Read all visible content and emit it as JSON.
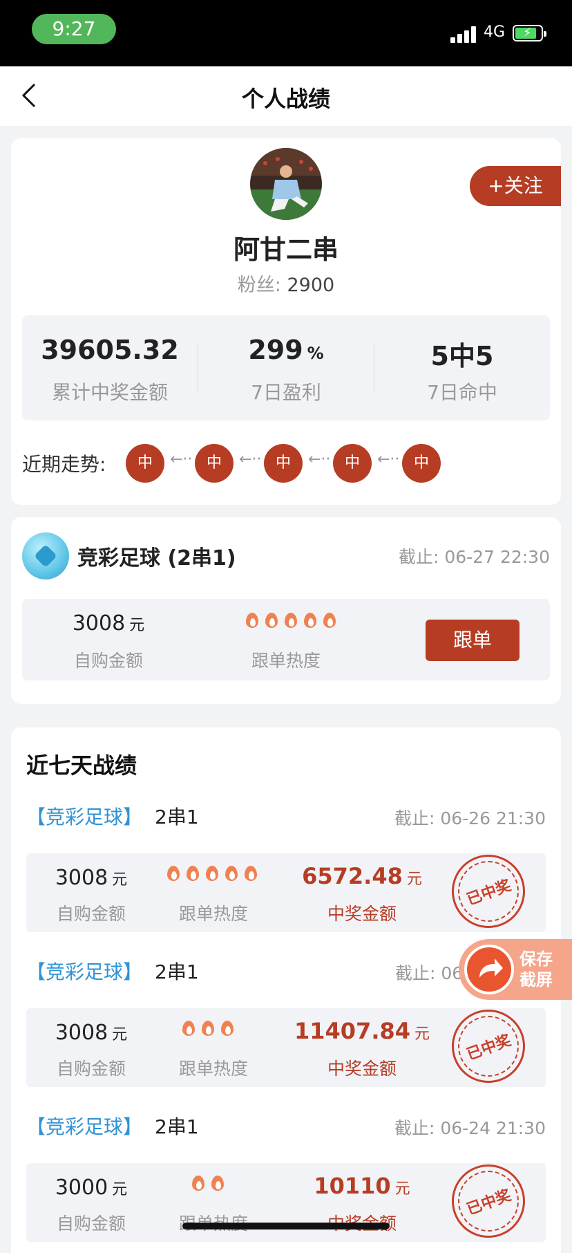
{
  "status_bar": {
    "time": "9:27",
    "network": "4G"
  },
  "nav": {
    "title": "个人战绩"
  },
  "profile": {
    "name": "阿甘二串",
    "fans_label": "粉丝:",
    "fans_value": "2900",
    "follow_label": "+关注",
    "stats": [
      {
        "value": "39605.32",
        "unit": "",
        "label": "累计中奖金额"
      },
      {
        "value": "299",
        "unit": "%",
        "label": "7日盈利"
      },
      {
        "value": "5中5",
        "unit": "",
        "label": "7日命中"
      }
    ],
    "trend_label": "近期走势:",
    "trend": [
      "中",
      "中",
      "中",
      "中",
      "中"
    ],
    "trend_arrow": "←··"
  },
  "current": {
    "title": "竞彩足球 (2串1)",
    "deadline": "截止: 06-27 22:30",
    "amount": "3008",
    "unit": "元",
    "amount_label": "自购金额",
    "heat_label": "跟单热度",
    "heat_level": 5,
    "follow_button": "跟单"
  },
  "history": {
    "title": "近七天战绩",
    "records": [
      {
        "tag": "【竞彩足球】",
        "kind": "2串1",
        "deadline": "截止: 06-26 21:30",
        "amount": "3008",
        "unit": "元",
        "amount_label": "自购金额",
        "heat_label": "跟单热度",
        "heat": 5,
        "win": "6572.48",
        "win_unit": "元",
        "win_label": "中奖金额",
        "stamp": "已中奖"
      },
      {
        "tag": "【竞彩足球】",
        "kind": "2串1",
        "deadline": "截止: 06",
        "amount": "3008",
        "unit": "元",
        "amount_label": "自购金额",
        "heat_label": "跟单热度",
        "heat": 3,
        "win": "11407.84",
        "win_unit": "元",
        "win_label": "中奖金额",
        "stamp": "已中奖"
      },
      {
        "tag": "【竞彩足球】",
        "kind": "2串1",
        "deadline": "截止: 06-24 21:30",
        "amount": "3000",
        "unit": "元",
        "amount_label": "自购金额",
        "heat_label": "跟单热度",
        "heat": 2,
        "win": "10110",
        "win_unit": "元",
        "win_label": "中奖金额",
        "stamp": "已中奖"
      }
    ]
  },
  "save_screenshot": {
    "line1": "保存",
    "line2": "截屏"
  },
  "colors": {
    "accent": "#b63d24",
    "tag_blue": "#2f92d4",
    "flame": "#ef8250",
    "background": "#f2f3f5"
  }
}
